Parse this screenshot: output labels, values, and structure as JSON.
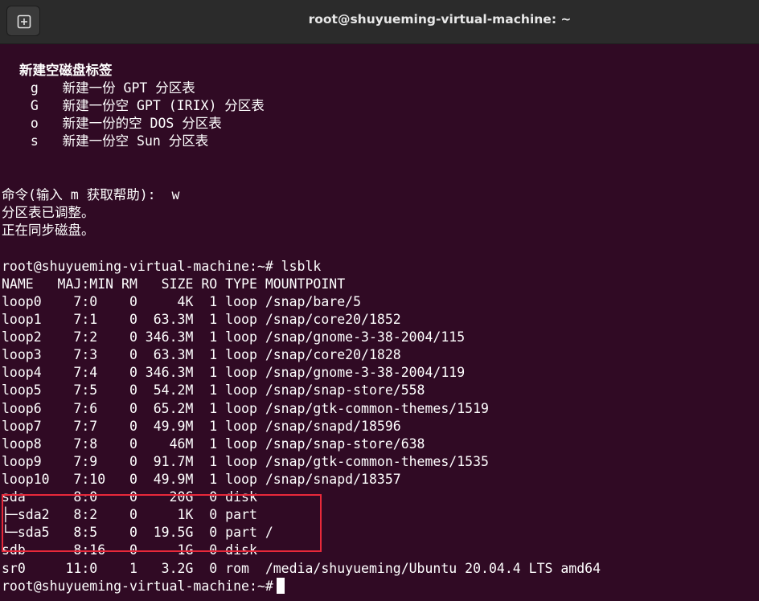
{
  "window": {
    "title": "root@shuyueming-virtual-machine: ~",
    "accent": "#300a24"
  },
  "titlebar": {
    "new_tab_icon": "new-tab-icon"
  },
  "terminal": {
    "menu_header": "新建空磁盘标签",
    "menu_items": [
      "  g   新建一份 GPT 分区表",
      "  G   新建一份空 GPT (IRIX) 分区表",
      "  o   新建一份的空 DOS 分区表",
      "  s   新建一份空 Sun 分区表"
    ],
    "command_prompt": "命令(输入 m 获取帮助):  w",
    "msg_adjusted": "分区表已调整。",
    "msg_syncing": "正在同步磁盘。",
    "prompt_lsblk": "root@shuyueming-virtual-machine:~# lsblk",
    "lsblk_header": "NAME   MAJ:MIN RM   SIZE RO TYPE MOUNTPOINT",
    "lsblk_rows": [
      "loop0    7:0    0     4K  1 loop /snap/bare/5",
      "loop1    7:1    0  63.3M  1 loop /snap/core20/1852",
      "loop2    7:2    0 346.3M  1 loop /snap/gnome-3-38-2004/115",
      "loop3    7:3    0  63.3M  1 loop /snap/core20/1828",
      "loop4    7:4    0 346.3M  1 loop /snap/gnome-3-38-2004/119",
      "loop5    7:5    0  54.2M  1 loop /snap/snap-store/558",
      "loop6    7:6    0  65.2M  1 loop /snap/gtk-common-themes/1519",
      "loop7    7:7    0  49.9M  1 loop /snap/snapd/18596",
      "loop8    7:8    0    46M  1 loop /snap/snap-store/638",
      "loop9    7:9    0  91.7M  1 loop /snap/gtk-common-themes/1535",
      "loop10   7:10   0  49.9M  1 loop /snap/snapd/18357",
      "sda      8:0    0    20G  0 disk",
      "├─sda2   8:2    0     1K  0 part",
      "└─sda5   8:5    0  19.5G  0 part /",
      "sdb      8:16   0     1G  0 disk",
      "sr0     11:0    1   3.2G  0 rom  /media/shuyueming/Ubuntu 20.04.4 LTS amd64"
    ],
    "final_prompt": "root@shuyueming-virtual-machine:~#",
    "highlight_color": "#e8293a"
  }
}
